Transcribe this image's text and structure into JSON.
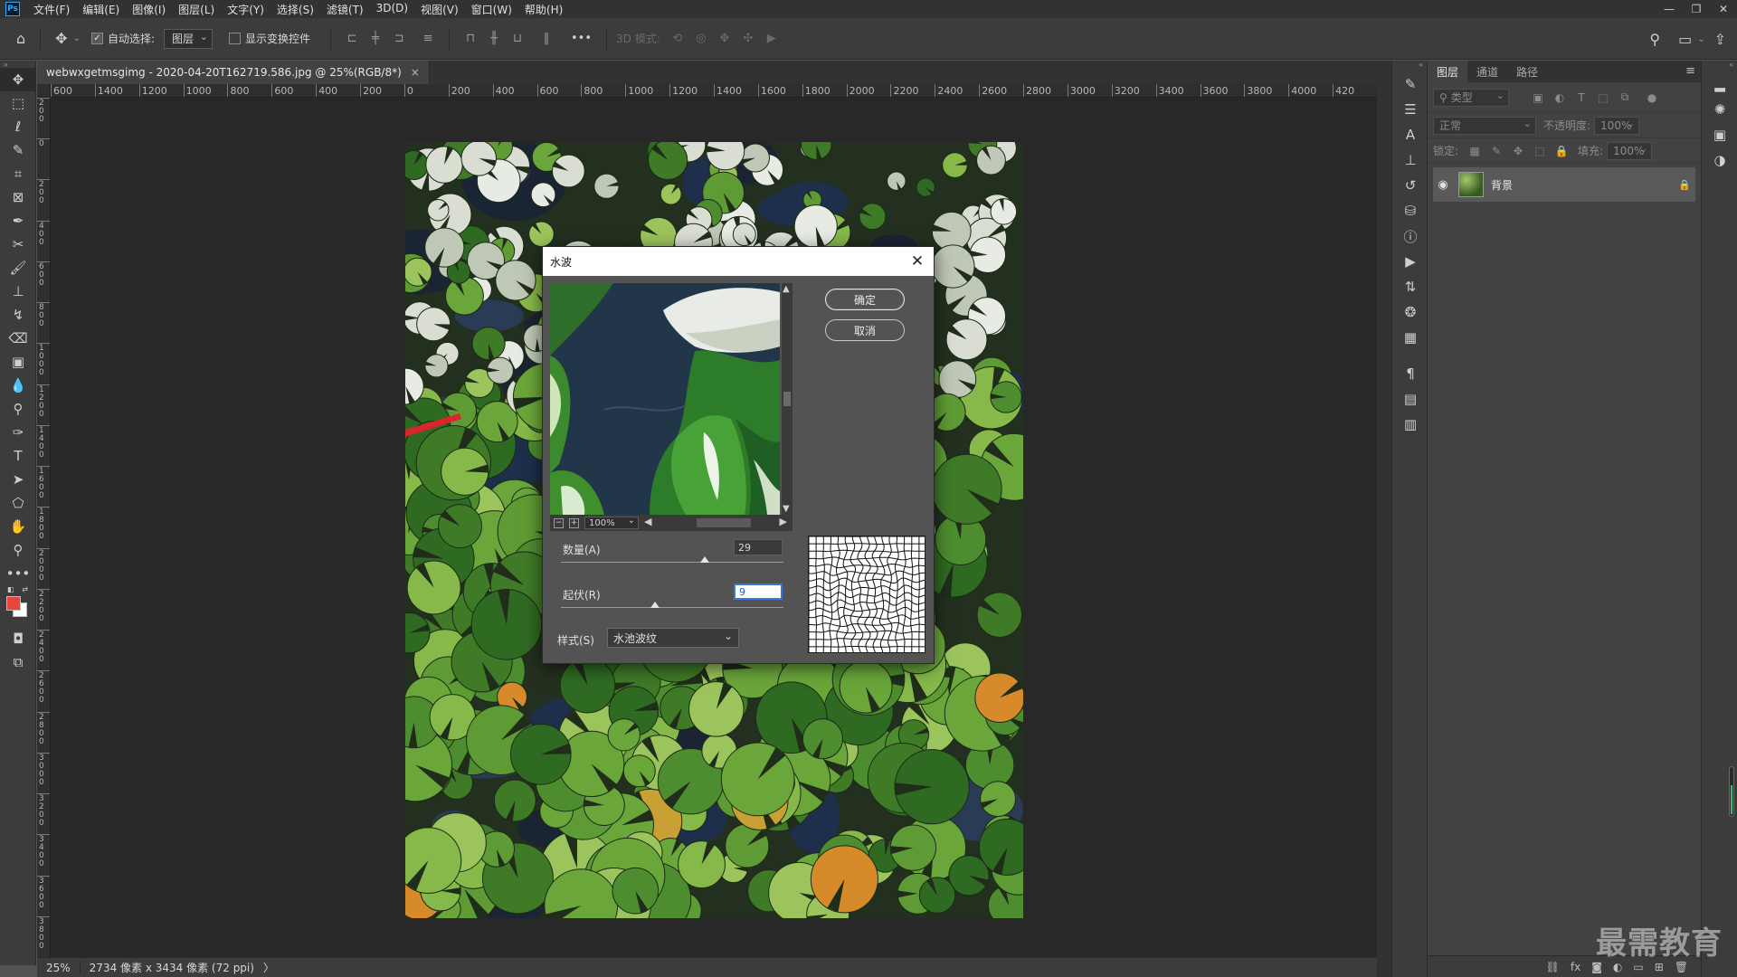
{
  "app": {
    "logo": "Ps"
  },
  "menu": [
    "文件(F)",
    "编辑(E)",
    "图像(I)",
    "图层(L)",
    "文字(Y)",
    "选择(S)",
    "滤镜(T)",
    "3D(D)",
    "视图(V)",
    "窗口(W)",
    "帮助(H)"
  ],
  "window_controls": {
    "minimize": "—",
    "restore": "❐",
    "close": "✕"
  },
  "options_bar": {
    "auto_select_label": "自动选择:",
    "auto_select_checked": true,
    "layer_select_value": "图层",
    "show_transform_label": "显示变换控件",
    "show_transform_checked": false,
    "more_icon": "•••",
    "mode_3d_label": "3D 模式:"
  },
  "document": {
    "tab_title": "webwxgetmsgimg - 2020-04-20T162719.586.jpg @ 25%(RGB/8*)",
    "close": "×"
  },
  "ruler_h_labels": [
    "600",
    "1400",
    "1200",
    "1000",
    "800",
    "600",
    "400",
    "200",
    "0",
    "200",
    "400",
    "600",
    "800",
    "1000",
    "1200",
    "1400",
    "1600",
    "1800",
    "2000",
    "2200",
    "2400",
    "2600",
    "2800",
    "3000",
    "3200",
    "3400",
    "3600",
    "3800",
    "4000",
    "420"
  ],
  "ruler_v_labels": [
    "200",
    "0",
    "200",
    "400",
    "600",
    "800",
    "1000",
    "1200",
    "1400",
    "1600",
    "1800",
    "2000",
    "2200",
    "2400",
    "2600",
    "2800",
    "3000",
    "3200",
    "3400",
    "3600",
    "3800"
  ],
  "status": {
    "zoom": "25%",
    "info": "2734 像素 x 3434 像素 (72 ppi)",
    "arrow": "〉"
  },
  "layers_panel": {
    "tabs": [
      "图层",
      "通道",
      "路径"
    ],
    "active_tab": 0,
    "filter_placeholder": "类型",
    "blend_mode": "正常",
    "opacity_label": "不透明度:",
    "opacity_value": "100%",
    "lock_label": "锁定:",
    "fill_label": "填充:",
    "fill_value": "100%",
    "layers": [
      {
        "name": "背景",
        "visible": true,
        "locked": true
      }
    ]
  },
  "dialog": {
    "title": "水波",
    "ok_label": "确定",
    "cancel_label": "取消",
    "preview_zoom": "100%",
    "amount_label": "数量(A)",
    "amount_value": "29",
    "amount_min": -100,
    "amount_max": 100,
    "ridges_label": "起伏(R)",
    "ridges_value": "9",
    "ridges_min": 1,
    "ridges_max": 20,
    "style_label": "样式(S)",
    "style_value": "水池波纹"
  },
  "watermark": "最需教育",
  "colors": {
    "foreground": "#e8453c",
    "background": "#ffffff",
    "focus_ring": "#3b78d8"
  },
  "icons": {
    "home": "⌂",
    "move": "✥",
    "search": "⚲",
    "panel_menu": "≡",
    "eye": "◉",
    "lock": "🔒"
  }
}
